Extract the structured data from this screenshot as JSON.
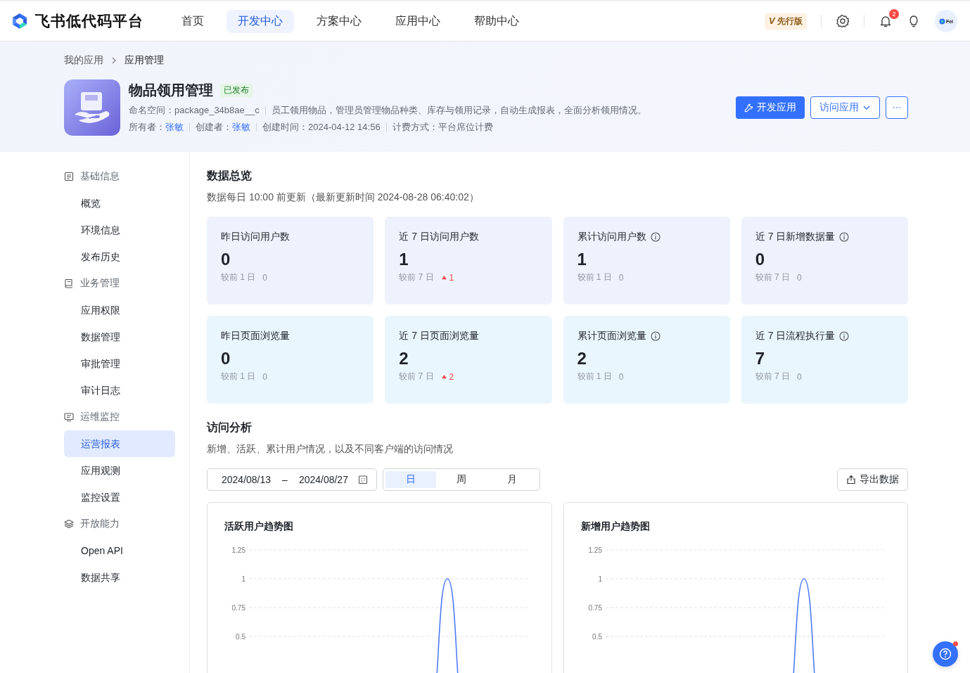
{
  "brand": {
    "name": "飞书低代码平台"
  },
  "nav": [
    {
      "label": "首页",
      "selected": false
    },
    {
      "label": "开发中心",
      "selected": true
    },
    {
      "label": "方案中心",
      "selected": false
    },
    {
      "label": "应用中心",
      "selected": false
    },
    {
      "label": "帮助中心",
      "selected": false
    }
  ],
  "header_right": {
    "edition_mark": "V",
    "edition": "先行版",
    "notification_count": "2",
    "avatar_text": "Fei"
  },
  "breadcrumb": [
    "我的应用",
    "应用管理"
  ],
  "app": {
    "name": "物品领用管理",
    "status": "已发布",
    "namespace_label": "命名空间：",
    "namespace": "package_34b8ae__c",
    "description": "员工领用物品，管理员管理物品种类、库存与领用记录，自动生成报表，全面分析领用情况。",
    "owner_label": "所有者：",
    "owner": "张敏",
    "creator_label": "创建者：",
    "creator": "张敏",
    "created_label": "创建时间：",
    "created": "2024-04-12 14:56",
    "billing_label": "计费方式：",
    "billing": "平台席位计费"
  },
  "actions": {
    "develop": "开发应用",
    "visit": "访问应用"
  },
  "sidebar": {
    "items": [
      {
        "label": "基础信息",
        "selected": false,
        "children": [
          {
            "label": "概览",
            "selected": false
          },
          {
            "label": "环境信息",
            "selected": false
          },
          {
            "label": "发布历史",
            "selected": false
          }
        ]
      },
      {
        "label": "业务管理",
        "selected": false,
        "children": [
          {
            "label": "应用权限",
            "selected": false
          },
          {
            "label": "数据管理",
            "selected": false
          },
          {
            "label": "审批管理",
            "selected": false
          },
          {
            "label": "审计日志",
            "selected": false
          }
        ]
      },
      {
        "label": "运维监控",
        "selected": false,
        "children": [
          {
            "label": "运营报表",
            "selected": true
          },
          {
            "label": "应用观测",
            "selected": false
          },
          {
            "label": "监控设置",
            "selected": false
          }
        ]
      },
      {
        "label": "开放能力",
        "selected": false,
        "children": [
          {
            "label": "Open API",
            "selected": false
          },
          {
            "label": "数据共享",
            "selected": false
          }
        ]
      }
    ]
  },
  "overview": {
    "title": "数据总览",
    "subtitle": "数据每日 10:00 前更新（最新更新时间 2024-08-28 06:40:02）",
    "rows": [
      {
        "color": "#eef2fd",
        "cards": [
          {
            "label": "昨日访问用户数",
            "info": false,
            "value": "0",
            "compare": "较前 1 日",
            "change": "0",
            "rising": false
          },
          {
            "label": "近 7 日访问用户数",
            "info": false,
            "value": "1",
            "compare": "较前 7 日",
            "change": "1",
            "rising": true
          },
          {
            "label": "累计访问用户数",
            "info": true,
            "value": "1",
            "compare": "较前 1 日",
            "change": "0",
            "rising": false
          },
          {
            "label": "近 7 日新增数据量",
            "info": true,
            "value": "0",
            "compare": "较前 7 日",
            "change": "0",
            "rising": false
          }
        ]
      },
      {
        "color": "#eaf6fd",
        "cards": [
          {
            "label": "昨日页面浏览量",
            "info": false,
            "value": "0",
            "compare": "较前 1 日",
            "change": "0",
            "rising": false
          },
          {
            "label": "近 7 日页面浏览量",
            "info": false,
            "value": "2",
            "compare": "较前 7 日",
            "change": "2",
            "rising": true
          },
          {
            "label": "累计页面浏览量",
            "info": true,
            "value": "2",
            "compare": "较前 1 日",
            "change": "0",
            "rising": false
          },
          {
            "label": "近 7 日流程执行量",
            "info": true,
            "value": "7",
            "compare": "较前 7 日",
            "change": "0",
            "rising": false
          }
        ]
      }
    ]
  },
  "analysis": {
    "title": "访问分析",
    "subtitle": "新增、活跃、累计用户情况，以及不同客户端的访问情况",
    "date_start": "2024/08/13",
    "date_sep": "–",
    "date_end": "2024/08/27",
    "periods": [
      {
        "label": "日",
        "selected": true
      },
      {
        "label": "周",
        "selected": false
      },
      {
        "label": "月",
        "selected": false
      }
    ],
    "export": "导出数据",
    "charts": [
      {
        "title": "活跃用户趋势图",
        "y_labels": [
          "1.25",
          "1",
          "0.75",
          "0.5"
        ]
      },
      {
        "title": "新增用户趋势图",
        "y_labels": [
          "1.25",
          "1",
          "0.75",
          "0.5"
        ]
      }
    ]
  }
}
